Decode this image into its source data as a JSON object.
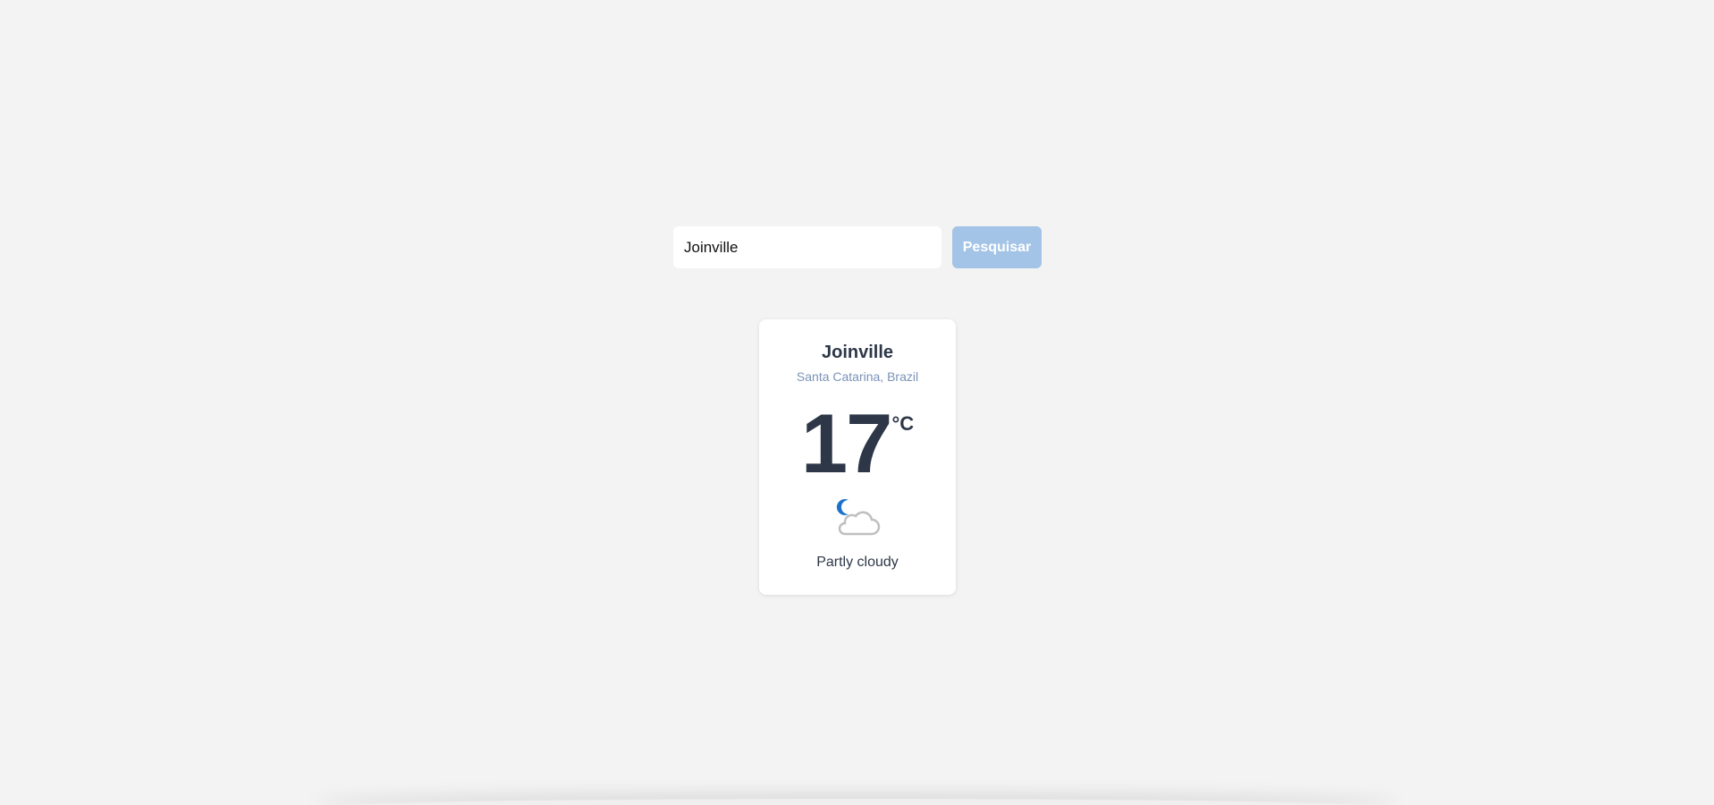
{
  "search": {
    "value": "Joinville",
    "button_label": "Pesquisar"
  },
  "weather": {
    "city": "Joinville",
    "region": "Santa Catarina, Brazil",
    "temperature": "17",
    "unit": "°C",
    "condition": "Partly cloudy",
    "icon": "partly-cloudy-night-icon"
  },
  "colors": {
    "background": "#f3f3f3",
    "button": "#a3c4e6",
    "text_dark": "#2d3748",
    "text_muted": "#7a93b8",
    "moon": "#1a73c8",
    "cloud_stroke": "#bfbfbf"
  }
}
